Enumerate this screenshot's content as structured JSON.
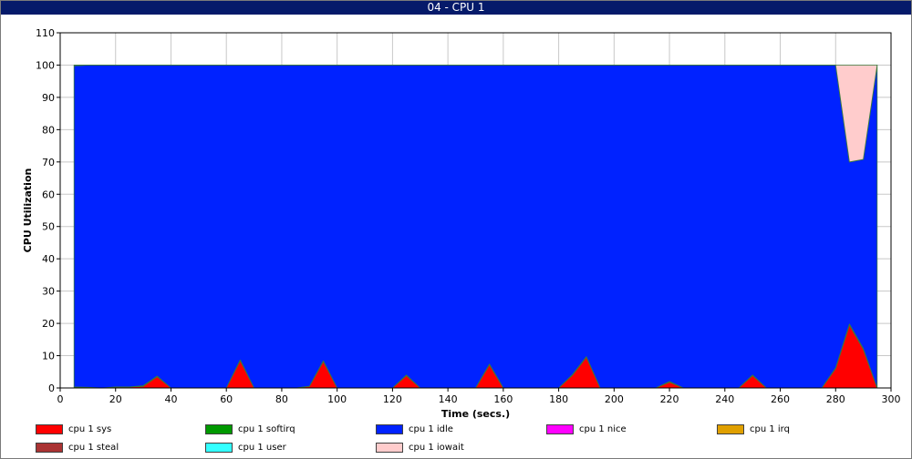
{
  "window": {
    "title": "04 - CPU 1"
  },
  "chart_data": {
    "type": "area",
    "stacked": true,
    "title": "04 - CPU 1",
    "xlabel": "Time (secs.)",
    "ylabel": "CPU Utilization",
    "xlim": [
      0,
      300
    ],
    "ylim": [
      0,
      110
    ],
    "xticks": [
      0,
      20,
      40,
      60,
      80,
      100,
      120,
      140,
      160,
      180,
      200,
      220,
      240,
      260,
      280,
      300
    ],
    "yticks": [
      0,
      10,
      20,
      30,
      40,
      50,
      60,
      70,
      80,
      90,
      100,
      110
    ],
    "grid": true,
    "legend_position": "bottom",
    "x": [
      5,
      10,
      15,
      20,
      25,
      30,
      35,
      40,
      45,
      50,
      55,
      60,
      65,
      70,
      75,
      80,
      85,
      90,
      95,
      100,
      105,
      110,
      115,
      120,
      125,
      130,
      135,
      140,
      145,
      150,
      155,
      160,
      165,
      170,
      175,
      180,
      185,
      190,
      195,
      200,
      205,
      210,
      215,
      220,
      225,
      230,
      235,
      240,
      245,
      250,
      255,
      260,
      265,
      270,
      275,
      280,
      285,
      290,
      295
    ],
    "series": [
      {
        "name": "cpu 1 sys",
        "color": "#ff0000",
        "values": [
          0,
          0,
          0,
          0.3,
          0.3,
          0.5,
          3.5,
          0,
          0,
          0,
          0,
          0,
          8.5,
          0,
          0,
          0,
          0,
          0.5,
          8.2,
          0,
          0,
          0,
          0,
          0,
          3.8,
          0,
          0,
          0,
          0,
          0,
          7.2,
          0,
          0,
          0,
          0,
          0,
          4,
          9.5,
          0,
          0,
          0,
          0,
          0,
          1.8,
          0,
          0,
          0,
          0,
          0,
          3.8,
          0,
          0,
          0,
          0,
          0,
          6,
          19.5,
          12,
          0
        ]
      },
      {
        "name": "cpu 1 softirq",
        "color": "#009900",
        "values": [
          0.3,
          0.2,
          0,
          0,
          0,
          0.2,
          0.2,
          0,
          0,
          0,
          0,
          0,
          0.2,
          0,
          0,
          0,
          0,
          0,
          0.2,
          0,
          0,
          0,
          0,
          0,
          0.2,
          0,
          0,
          0,
          0,
          0,
          0.2,
          0,
          0,
          0,
          0,
          0,
          0.2,
          0.2,
          0,
          0,
          0,
          0,
          0,
          0.2,
          0,
          0,
          0,
          0,
          0,
          0.2,
          0,
          0,
          0,
          0,
          0,
          0.2,
          0.3,
          0.2,
          0
        ]
      },
      {
        "name": "cpu 1 idle",
        "color": "#0022ff",
        "values": [
          99.5,
          99.8,
          100,
          99.7,
          99.7,
          99.3,
          96.3,
          100,
          100,
          100,
          100,
          100,
          91.3,
          100,
          100,
          100,
          100,
          99.5,
          91.6,
          100,
          100,
          100,
          100,
          100,
          96,
          100,
          100,
          100,
          100,
          100,
          92.6,
          100,
          100,
          100,
          100,
          100,
          95.8,
          90.3,
          100,
          100,
          100,
          100,
          100,
          98,
          100,
          100,
          100,
          100,
          100,
          96,
          100,
          100,
          100,
          100,
          100,
          93.8,
          50.2,
          58.6,
          100
        ]
      },
      {
        "name": "cpu 1 nice",
        "color": "#ff00ff",
        "values": [
          0,
          0,
          0,
          0,
          0,
          0,
          0,
          0,
          0,
          0,
          0,
          0,
          0,
          0,
          0,
          0,
          0,
          0,
          0,
          0,
          0,
          0,
          0,
          0,
          0,
          0,
          0,
          0,
          0,
          0,
          0,
          0,
          0,
          0,
          0,
          0,
          0,
          0,
          0,
          0,
          0,
          0,
          0,
          0,
          0,
          0,
          0,
          0,
          0,
          0,
          0,
          0,
          0,
          0,
          0,
          0,
          0,
          0,
          0
        ]
      },
      {
        "name": "cpu 1 irq",
        "color": "#e0a000",
        "values": [
          0,
          0,
          0,
          0,
          0,
          0,
          0,
          0,
          0,
          0,
          0,
          0,
          0,
          0,
          0,
          0,
          0,
          0,
          0,
          0,
          0,
          0,
          0,
          0,
          0,
          0,
          0,
          0,
          0,
          0,
          0,
          0,
          0,
          0,
          0,
          0,
          0,
          0,
          0,
          0,
          0,
          0,
          0,
          0,
          0,
          0,
          0,
          0,
          0,
          0,
          0,
          0,
          0,
          0,
          0,
          0,
          0,
          0,
          0
        ]
      },
      {
        "name": "cpu 1 steal",
        "color": "#aa3333",
        "values": [
          0,
          0,
          0,
          0,
          0,
          0,
          0,
          0,
          0,
          0,
          0,
          0,
          0,
          0,
          0,
          0,
          0,
          0,
          0,
          0,
          0,
          0,
          0,
          0,
          0,
          0,
          0,
          0,
          0,
          0,
          0,
          0,
          0,
          0,
          0,
          0,
          0,
          0,
          0,
          0,
          0,
          0,
          0,
          0,
          0,
          0,
          0,
          0,
          0,
          0,
          0,
          0,
          0,
          0,
          0,
          0,
          0,
          0,
          0
        ]
      },
      {
        "name": "cpu 1 user",
        "color": "#33ffff",
        "values": [
          0.2,
          0,
          0,
          0,
          0,
          0,
          0,
          0,
          0,
          0,
          0,
          0,
          0,
          0,
          0,
          0,
          0,
          0,
          0,
          0,
          0,
          0,
          0,
          0,
          0,
          0,
          0,
          0,
          0,
          0,
          0,
          0,
          0,
          0,
          0,
          0,
          0,
          0,
          0,
          0,
          0,
          0,
          0,
          0,
          0,
          0,
          0,
          0,
          0,
          0,
          0,
          0,
          0,
          0,
          0,
          0,
          0,
          0,
          0
        ]
      },
      {
        "name": "cpu 1 iowait",
        "color": "#ffcccc",
        "values": [
          0,
          0,
          0,
          0,
          0,
          0,
          0,
          0,
          0,
          0,
          0,
          0,
          0,
          0,
          0,
          0,
          0,
          0,
          0,
          0,
          0,
          0,
          0,
          0,
          0,
          0,
          0,
          0,
          0,
          0,
          0,
          0,
          0,
          0,
          0,
          0,
          0,
          0,
          0,
          0,
          0,
          0,
          0,
          0,
          0,
          0,
          0,
          0,
          0,
          0,
          0,
          0,
          0,
          0,
          0,
          0,
          30,
          29.2,
          0
        ]
      }
    ]
  }
}
